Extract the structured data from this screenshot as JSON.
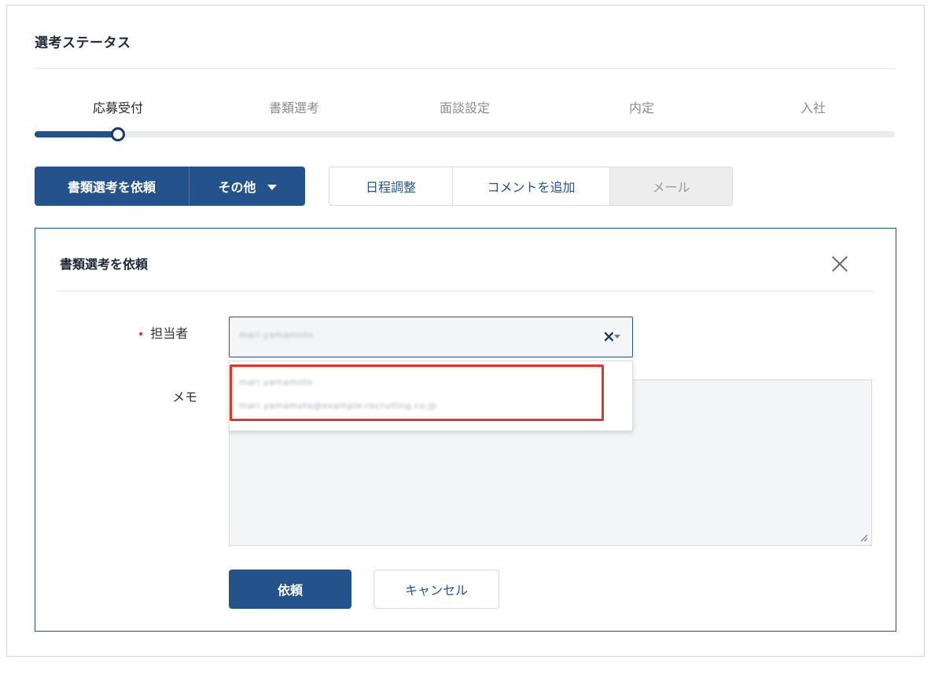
{
  "section": {
    "title": "選考ステータス"
  },
  "steps": {
    "items": [
      {
        "label": "応募受付",
        "active": true
      },
      {
        "label": "書類選考",
        "active": false
      },
      {
        "label": "面談設定",
        "active": false
      },
      {
        "label": "内定",
        "active": false
      },
      {
        "label": "入社",
        "active": false
      }
    ],
    "current_index": 0
  },
  "actions": {
    "request_label": "書類選考を依頼",
    "other_label": "その他",
    "schedule_label": "日程調整",
    "comment_label": "コメントを追加",
    "mail_label": "メール"
  },
  "panel": {
    "title": "書類選考を依頼",
    "assignee_label": "担当者",
    "memo_label": "メモ",
    "assignee_value": "mari.yamamoto",
    "dropdown_options": [
      "mari.yamamoto",
      "mari.yamamoto@example-recruiting.co.jp"
    ],
    "submit_label": "依頼",
    "cancel_label": "キャンセル",
    "required_mark": "•"
  },
  "colors": {
    "primary": "#24538c",
    "highlight": "#e0362c",
    "required": "#c0392b"
  },
  "icons": {
    "close": "close-icon",
    "clear": "clear-icon",
    "caret": "caret-down-icon",
    "resize": "resize-handle-icon"
  }
}
